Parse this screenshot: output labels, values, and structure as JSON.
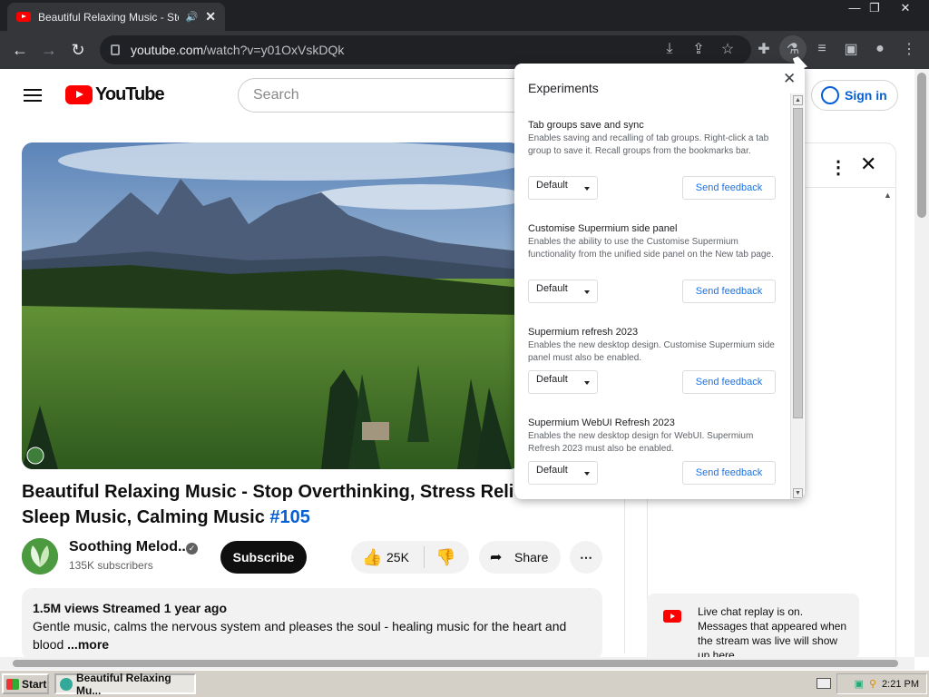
{
  "browser": {
    "tab_title": "Beautiful Relaxing Music - Stop",
    "url_host": "youtube.com",
    "url_path": "/watch?v=y01OxVskDQk"
  },
  "youtube": {
    "logo_text": "YouTube",
    "search_placeholder": "Search",
    "signin_label": "Sign in",
    "video_title_text": "Beautiful Relaxing Music - Stop Overthinking, Stress Relief M",
    "video_title_line2": "Sleep Music, Calming Music",
    "video_title_hashtag": "#105",
    "channel_name": "Soothing Melod...",
    "subscribers": "135K subscribers",
    "subscribe_label": "Subscribe",
    "like_count": "25K",
    "share_label": "Share",
    "description": {
      "stats": "1.5M views  Streamed 1 year ago",
      "line1": "Gentle music, calms the nervous system and pleases the soul - healing music for the heart and",
      "line2": "blood ",
      "more": "...more"
    },
    "live_chat_text": "Live chat replay is on. Messages that appeared when the stream was live will show up here."
  },
  "experiments": {
    "title": "Experiments",
    "items": [
      {
        "name": "Tab groups save and sync",
        "description": "Enables saving and recalling of tab groups. Right-click a tab group to save it. Recall groups from the bookmarks bar.",
        "select": "Default",
        "feedback": "Send feedback"
      },
      {
        "name": "Customise Supermium side panel",
        "description": "Enables the ability to use the Customise Supermium functionality from the unified side panel on the New tab page.",
        "select": "Default",
        "feedback": "Send feedback"
      },
      {
        "name": "Supermium refresh 2023",
        "description": "Enables the new desktop design. Customise Supermium side panel must also be enabled.",
        "select": "Default",
        "feedback": "Send feedback"
      },
      {
        "name": "Supermium WebUI Refresh 2023",
        "description": "Enables the new desktop design for WebUI. Supermium Refresh 2023 must also be enabled.",
        "select": "Default",
        "feedback": "Send feedback"
      }
    ]
  },
  "taskbar": {
    "start_label": "Start",
    "task_label": "Beautiful Relaxing Mu...",
    "clock": "2:21 PM"
  }
}
